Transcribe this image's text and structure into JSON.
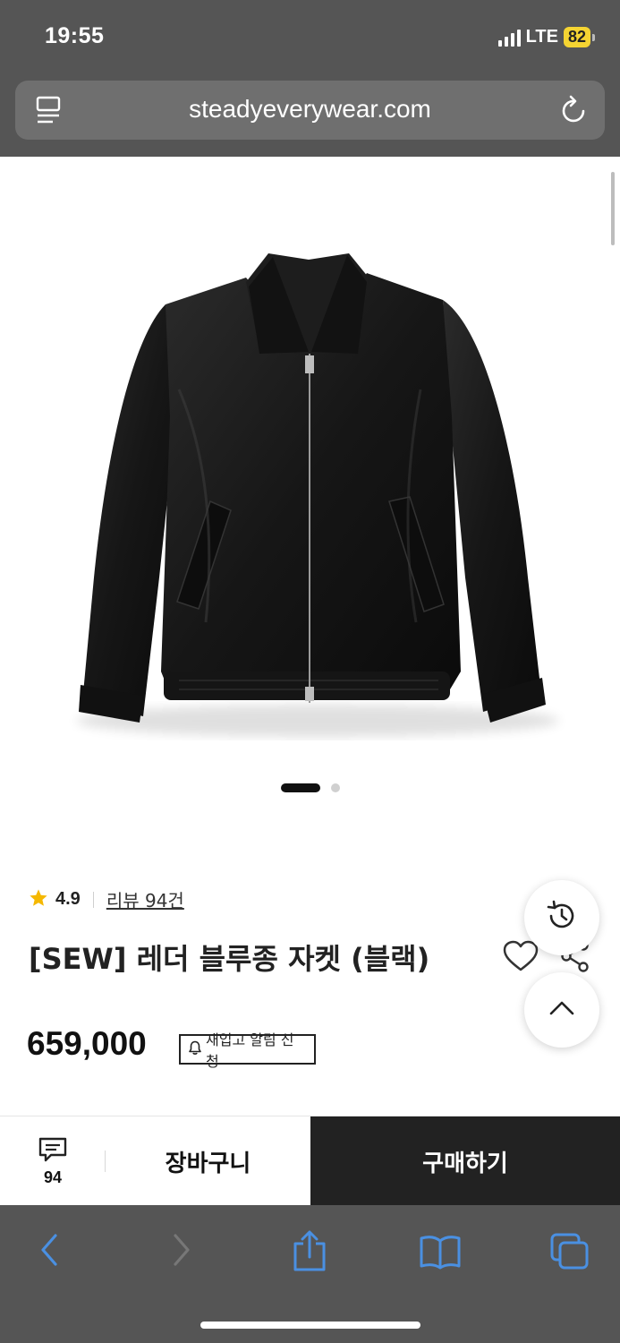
{
  "status_bar": {
    "time": "19:55",
    "network": "LTE",
    "battery": "82"
  },
  "browser": {
    "url": "steadyeverywear.com"
  },
  "product": {
    "rating": "4.9",
    "review_link": "리뷰 94건",
    "title": "[SEW] 레더 블루종 자켓 (블랙)",
    "price": "659,000",
    "restock_label": "재입고 알림 신청"
  },
  "image_carousel": {
    "total": 2,
    "active_index": 0
  },
  "action_bar": {
    "review_count": "94",
    "cart_label": "장바구니",
    "buy_label": "구매하기"
  },
  "colors": {
    "chrome": "#555555",
    "buy_button": "#222222",
    "star": "#f5b800",
    "battery": "#f5d432",
    "toolbar_icon": "#4a90e2"
  }
}
